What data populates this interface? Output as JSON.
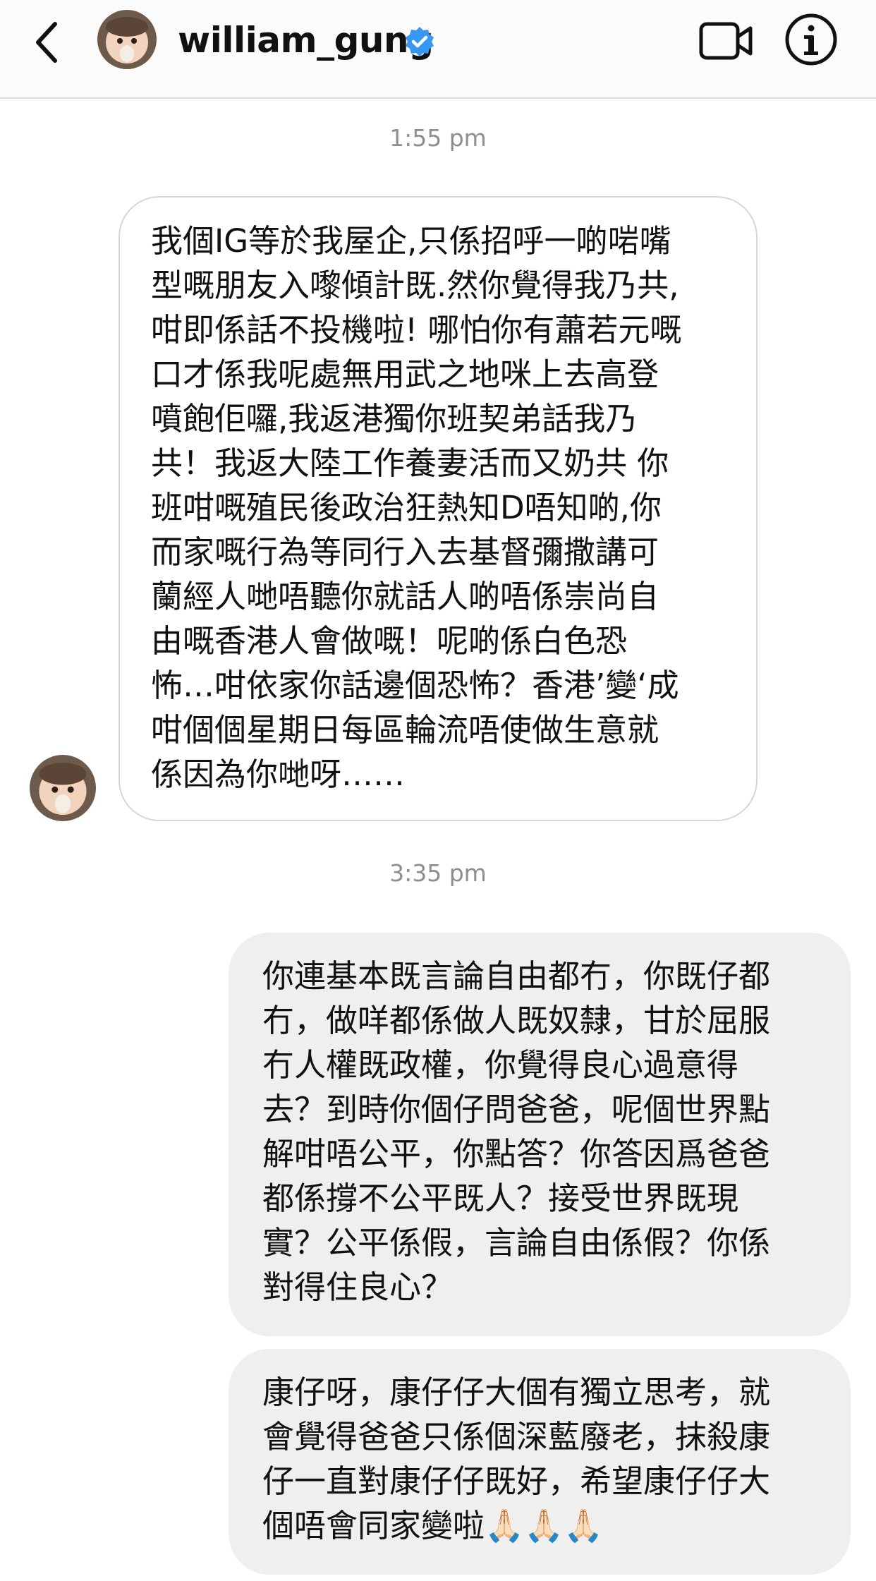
{
  "header": {
    "username": "william_gung",
    "back_icon": "chevron-left-icon",
    "video_icon": "video-camera-icon",
    "info_icon": "info-icon",
    "verified_icon": "verified-badge-icon",
    "verified_color": "#3897f0"
  },
  "messages": [
    {
      "timestamp": "1:55 pm",
      "direction": "incoming",
      "text": "我個IG等於我屋企,只係招呼一啲啱嘴\n型嘅朋友入嚟傾計既.然你覺得我乃共,\n咁即係話不投機啦! 哪怕你有蕭若元嘅\n口才係我呢處無用武之地咪上去高登\n噴飽佢囉,我返港獨你班契弟話我乃\n共！我返大陸工作養妻活而又奶共 你\n班咁嘅殖民後政治狂熱知D唔知啲,你\n而家嘅行為等同行入去基督彌撒講可\n蘭經人哋唔聽你就話人啲唔係崇尚自\n由嘅香港人會做嘅！呢啲係白色恐\n怖…咁依家你話邊個恐怖？香港’變‘成\n咁個個星期日每區輪流唔使做生意就\n係因為你哋呀……"
    },
    {
      "timestamp": "3:35 pm",
      "direction": "outgoing",
      "text": "你連基本既言論自由都冇，你既仔都\n冇，做咩都係做人既奴隸，甘於屈服\n冇人權既政權，你覺得良心過意得\n去？到時你個仔問爸爸，呢個世界點\n解咁唔公平，你點答？你答因爲爸爸\n都係撐不公平既人？接受世界既現\n實？公平係假，言論自由係假？你係\n對得住良心？"
    },
    {
      "direction": "outgoing",
      "text": "康仔呀，康仔仔大個有獨立思考，就\n會覺得爸爸只係個深藍廢老，抹殺康\n仔一直對康仔仔既好，希望康仔仔大\n個唔會同家變啦🙏🏻🙏🏻🙏🏻"
    }
  ],
  "colors": {
    "incoming_bubble_border": "#d6d6d6",
    "outgoing_bubble_bg": "#efefef",
    "timestamp_text": "#8e8e8e"
  }
}
